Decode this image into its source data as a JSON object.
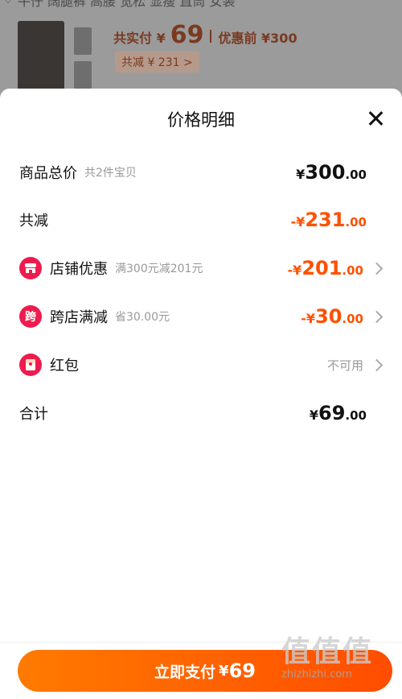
{
  "background": {
    "title": "牛仔 阔腿裤 高腰 宽松 显瘦 直筒 女装",
    "price_label": "共实付 ¥",
    "price_value": "69",
    "orig_price": "优惠前 ¥300",
    "discount_chip": "共减 ¥ 231 >"
  },
  "sheet": {
    "title": "价格明细",
    "items_total": {
      "label": "商品总价",
      "sub": "共2件宝贝",
      "pre": "¥",
      "int": "300",
      "dec": ".00"
    },
    "reduce_total": {
      "label": "共减",
      "pre": "-¥",
      "int": "231",
      "dec": ".00"
    },
    "shop_discount": {
      "label": "店铺优惠",
      "sub": "满300元减201元",
      "pre": "-¥",
      "int": "201",
      "dec": ".00",
      "icon": "shop-icon",
      "icon_color": "#ee1c4e"
    },
    "cross_shop": {
      "label": "跨店满减",
      "sub": "省30.00元",
      "pre": "-¥",
      "int": "30",
      "dec": ".00",
      "icon": "cross-shop-icon",
      "icon_glyph": "跨",
      "icon_color": "#ee1c4e"
    },
    "red_packet": {
      "label": "红包",
      "status": "不可用",
      "icon": "red-packet-icon",
      "icon_color": "#ee1c4e"
    },
    "total": {
      "label": "合计",
      "pre": "¥",
      "int": "69",
      "dec": ".00"
    }
  },
  "footer": {
    "pay_label": "立即支付",
    "pay_yen": "¥",
    "pay_amount": "69"
  },
  "watermark": {
    "big": "值值值",
    "site": "zhizhizhi.com"
  },
  "colors": {
    "accent": "#ff5000",
    "badge": "#ee1c4e"
  }
}
